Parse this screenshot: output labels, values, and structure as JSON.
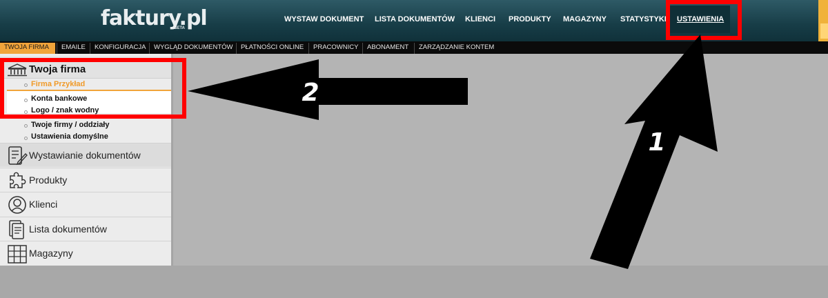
{
  "app": {
    "logo": "faktury.pl",
    "logo_badge": "BETA"
  },
  "topnav": {
    "items": [
      {
        "label": "WYSTAW DOKUMENT"
      },
      {
        "label": "LISTA DOKUMENTÓW"
      },
      {
        "label": "KLIENCI"
      },
      {
        "label": "PRODUKTY"
      },
      {
        "label": "MAGAZYNY"
      },
      {
        "label": "STATYSTYKI"
      },
      {
        "label": "USTAWIENIA",
        "active": true
      }
    ]
  },
  "subnav": {
    "items": [
      {
        "label": "TWOJA FIRMA",
        "active": true
      },
      {
        "label": "EMAILE"
      },
      {
        "label": "KONFIGURACJA"
      },
      {
        "label": "WYGLĄD DOKUMENTÓW"
      },
      {
        "label": "PŁATNOŚCI ONLINE"
      },
      {
        "label": "PRACOWNICY"
      },
      {
        "label": "ABONAMENT"
      },
      {
        "label": "ZARZĄDZANIE KONTEM"
      }
    ]
  },
  "sidebar": {
    "firm_section": {
      "title": "Twoja firma",
      "items": [
        {
          "label": "Firma Przykład",
          "active": true
        },
        {
          "label": "Konta bankowe"
        },
        {
          "label": "Logo / znak wodny"
        },
        {
          "label": "Twoje firmy / oddziały"
        },
        {
          "label": "Ustawienia domyślne"
        }
      ]
    },
    "menu": [
      {
        "label": "Wystawianie dokumentów",
        "icon": "document-edit-icon"
      },
      {
        "label": "Produkty",
        "icon": "puzzle-icon"
      },
      {
        "label": "Klienci",
        "icon": "user-icon"
      },
      {
        "label": "Lista dokumentów",
        "icon": "documents-icon"
      },
      {
        "label": "Magazyny",
        "icon": "warehouse-icon"
      }
    ]
  },
  "annotations": {
    "label_1": "1",
    "label_2": "2",
    "color": "#ff0000"
  },
  "colors": {
    "header": "#1f4550",
    "accent": "#f1a43a",
    "subnav": "#0b0b0b"
  }
}
